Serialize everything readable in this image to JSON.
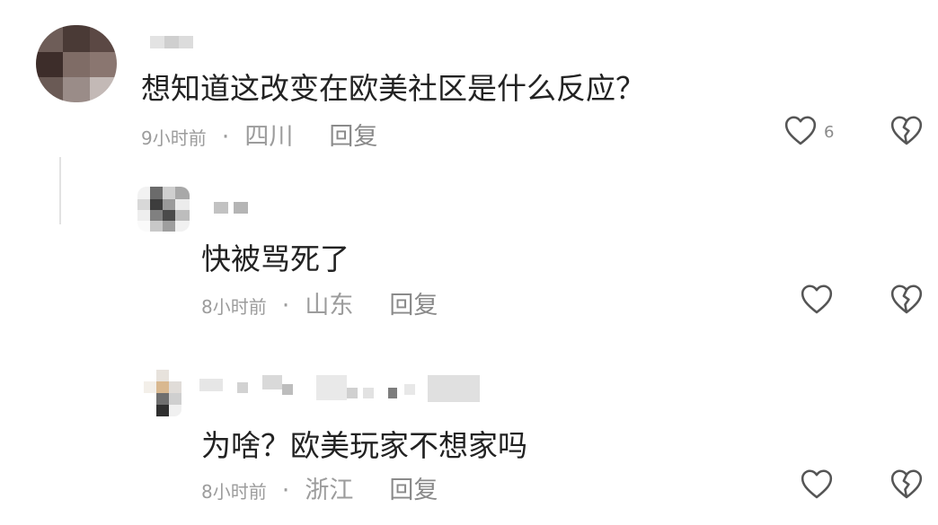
{
  "colors": {
    "text": "#222222",
    "meta": "#9c9c9c",
    "icon": "#555555"
  },
  "comments": [
    {
      "text": "想知道这改变在欧美社区是什么反应？",
      "time": "9小时前",
      "location": "四川",
      "reply_label": "回复",
      "likes": "6",
      "like_icon": "heart-outline-icon",
      "dislike_icon": "broken-heart-icon"
    },
    {
      "text": "快被骂死了",
      "time": "8小时前",
      "location": "山东",
      "reply_label": "回复",
      "like_icon": "heart-outline-icon",
      "dislike_icon": "broken-heart-icon"
    },
    {
      "text": "为啥？欧美玩家不想家吗",
      "time": "8小时前",
      "location": "浙江",
      "reply_label": "回复",
      "like_icon": "heart-outline-icon",
      "dislike_icon": "broken-heart-icon"
    }
  ]
}
